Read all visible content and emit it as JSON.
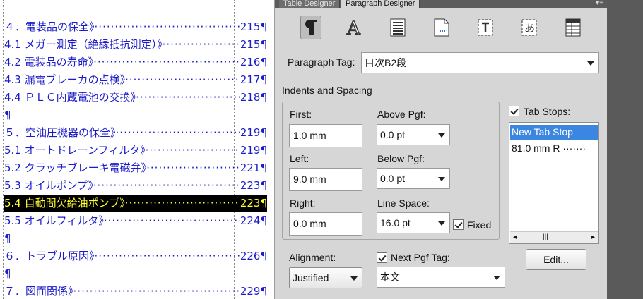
{
  "document": {
    "toc": [
      {
        "text": "４．電装品の保全",
        "page": "215"
      },
      {
        "text": "4.1 メガー測定（絶縁抵抗測定）",
        "page": "215"
      },
      {
        "text": "4.2 電装品の寿命",
        "page": "216"
      },
      {
        "text": "4.3 漏電ブレーカの点検",
        "page": "217"
      },
      {
        "text": "4.4 ＰＬＣ内蔵電池の交換",
        "page": "218"
      },
      {
        "text": "５．空油圧機器の保全",
        "page": "219"
      },
      {
        "text": "5.1 オートドレーンフィルタ",
        "page": "219"
      },
      {
        "text": "5.2 クラッチブレーキ電磁弁",
        "page": "221"
      },
      {
        "text": "5.3 オイルポンプ",
        "page": "223"
      },
      {
        "text": "5.4 自動間欠給油ポンプ",
        "page": "223"
      },
      {
        "text": "5.5 オイルフィルタ",
        "page": "224"
      },
      {
        "text": "６．トラブル原因",
        "page": "226"
      },
      {
        "text": "７．図面関係",
        "page": "229"
      }
    ],
    "tab_marker": "》",
    "pilcrow": "¶",
    "selected_index": 9
  },
  "panel": {
    "tabs": [
      "Table Designer",
      "Paragraph Designer"
    ],
    "active_tab": "Paragraph Designer",
    "menu_glyph": "▾≡",
    "icons": [
      "pilcrow-icon",
      "font-icon",
      "paragraph-lines-icon",
      "page-icon",
      "text-frame-icon",
      "asian-text-icon",
      "table-icon"
    ],
    "paragraph_tag_label": "Paragraph Tag:",
    "paragraph_tag_value": "目次B2段",
    "section_title": "Indents and Spacing",
    "first_label": "First:",
    "first_value": "1.0 mm",
    "left_label": "Left:",
    "left_value": "9.0 mm",
    "right_label": "Right:",
    "right_value": "0.0 mm",
    "above_label": "Above Pgf:",
    "above_value": "0.0 pt",
    "below_label": "Below Pgf:",
    "below_value": "0.0 pt",
    "line_space_label": "Line Space:",
    "line_space_value": "16.0 pt",
    "fixed_label": "Fixed",
    "fixed_checked": true,
    "tab_stops_label": "Tab Stops:",
    "tab_stops_checked": true,
    "tab_stops": [
      "New Tab Stop",
      "81.0 mm  R  ·······"
    ],
    "scroll_left": "◂",
    "scroll_thumb": "|||",
    "scroll_right": "▸",
    "edit_button": "Edit...",
    "alignment_label": "Alignment:",
    "alignment_value": "Justified",
    "next_pgf_label": "Next Pgf Tag:",
    "next_pgf_checked": true,
    "next_pgf_value": "本文"
  }
}
